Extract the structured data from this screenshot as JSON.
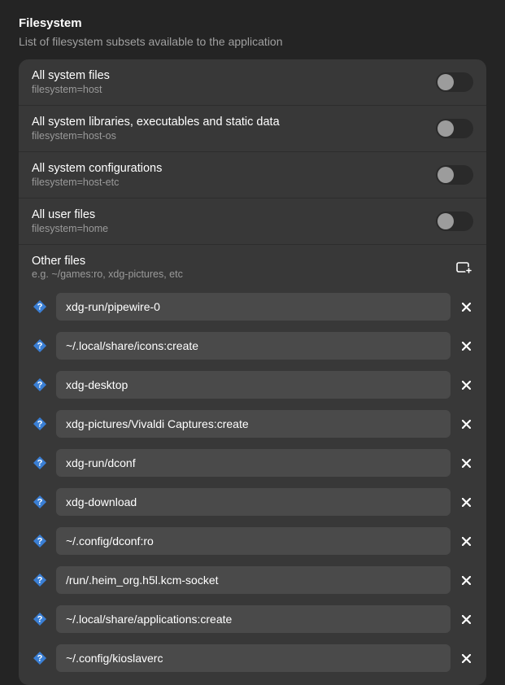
{
  "section": {
    "title": "Filesystem",
    "description": "List of filesystem subsets available to the application"
  },
  "toggles": [
    {
      "title": "All system files",
      "sub": "filesystem=host",
      "on": false
    },
    {
      "title": "All system libraries, executables and static data",
      "sub": "filesystem=host-os",
      "on": false
    },
    {
      "title": "All system configurations",
      "sub": "filesystem=host-etc",
      "on": false
    },
    {
      "title": "All user files",
      "sub": "filesystem=home",
      "on": false
    }
  ],
  "other": {
    "title": "Other files",
    "sub": "e.g. ~/games:ro, xdg-pictures, etc"
  },
  "files": [
    {
      "value": "xdg-run/pipewire-0"
    },
    {
      "value": "~/.local/share/icons:create"
    },
    {
      "value": "xdg-desktop"
    },
    {
      "value": "xdg-pictures/Vivaldi Captures:create"
    },
    {
      "value": "xdg-run/dconf"
    },
    {
      "value": "xdg-download"
    },
    {
      "value": "~/.config/dconf:ro"
    },
    {
      "value": "/run/.heim_org.h5l.kcm-socket"
    },
    {
      "value": "~/.local/share/applications:create"
    },
    {
      "value": "~/.config/kioslaverc"
    }
  ],
  "colors": {
    "accent": "#3a7fd5"
  }
}
